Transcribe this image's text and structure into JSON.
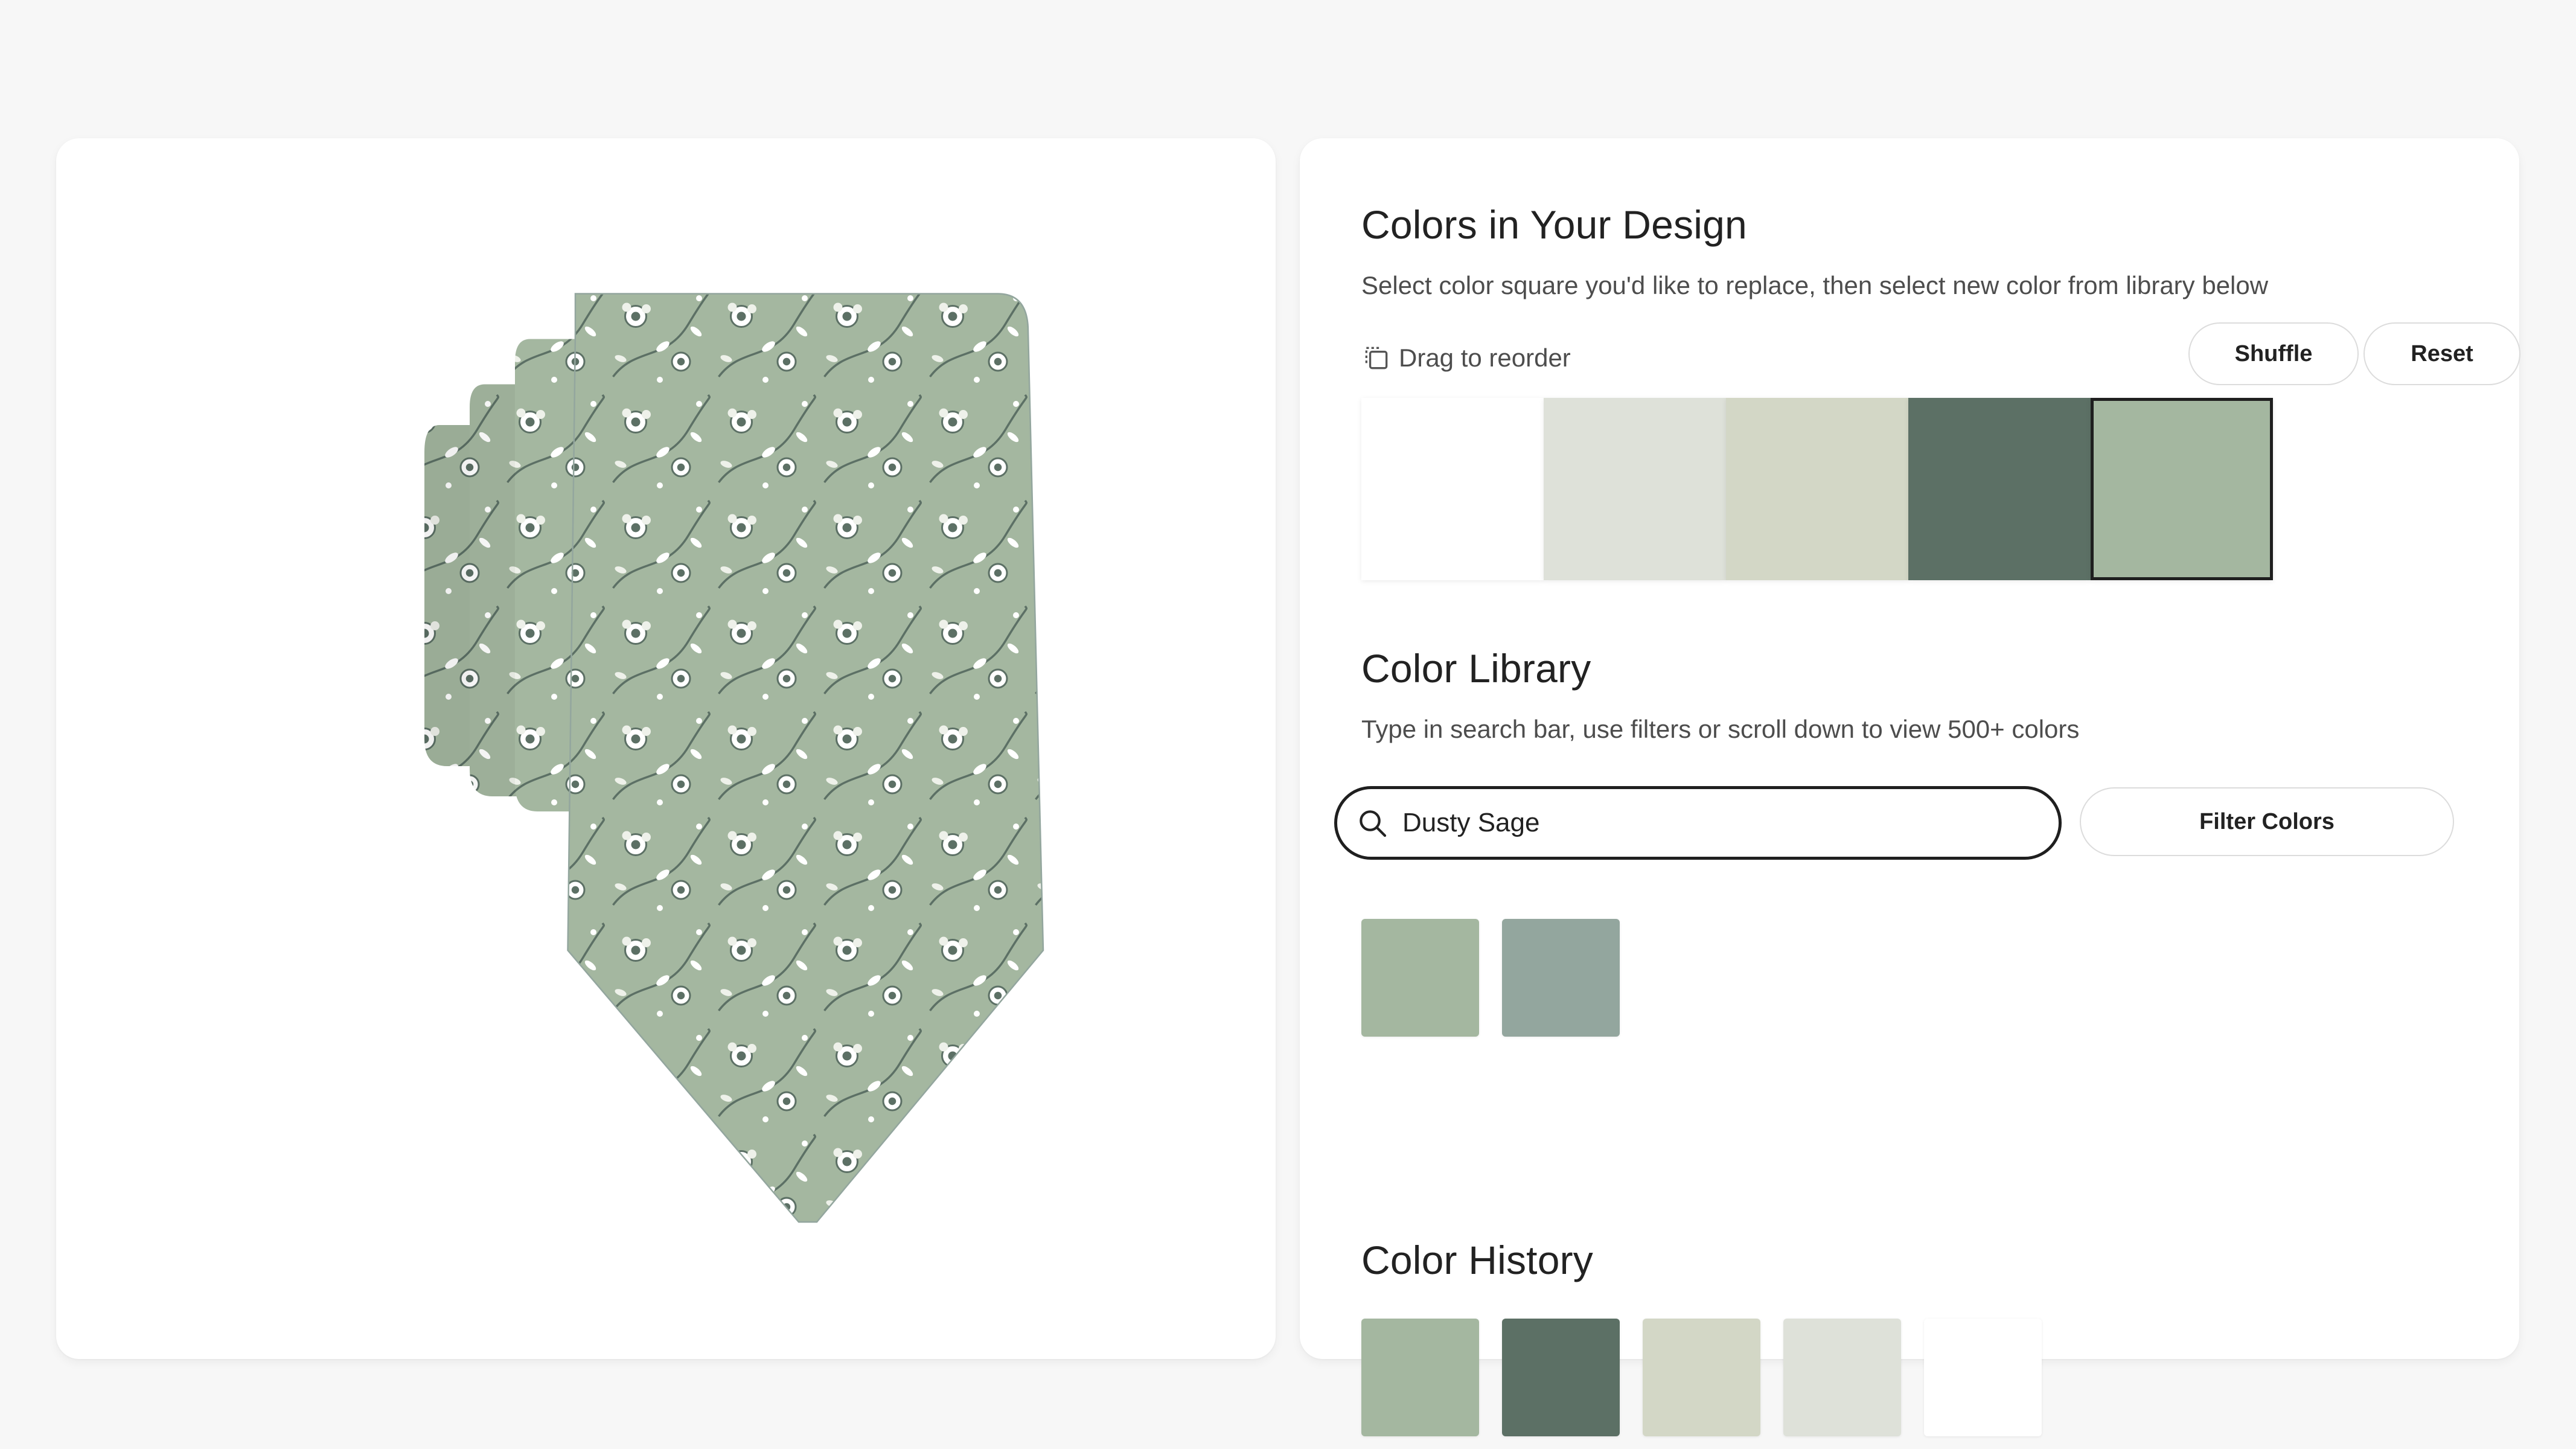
{
  "design_section": {
    "title": "Colors in Your Design",
    "description": "Select color square you'd like to replace, then select new color from library below",
    "drag_label": "Drag to reorder",
    "shuffle_label": "Shuffle",
    "reset_label": "Reset",
    "swatches": [
      "#ffffff",
      "#dee1d9",
      "#d3d7c6",
      "#5c7065",
      "#a4b7a0"
    ],
    "selected_index": 4
  },
  "library_section": {
    "title": "Color Library",
    "description": "Type in search bar, use filters or scroll down to view 500+ colors",
    "search_value": "Dusty Sage",
    "filter_label": "Filter Colors",
    "results": [
      "#a4b7a0",
      "#93a69e"
    ]
  },
  "history_section": {
    "title": "Color History",
    "swatches": [
      "#a4b7a0",
      "#5c7065",
      "#d3d7c6",
      "#dee1d9",
      "#ffffff"
    ]
  },
  "product": {
    "base_color": "#a4b7a0",
    "accent_dark": "#5c7065",
    "accent_light": "#ffffff"
  },
  "icons": [
    "drag-reorder-icon",
    "search-icon"
  ]
}
